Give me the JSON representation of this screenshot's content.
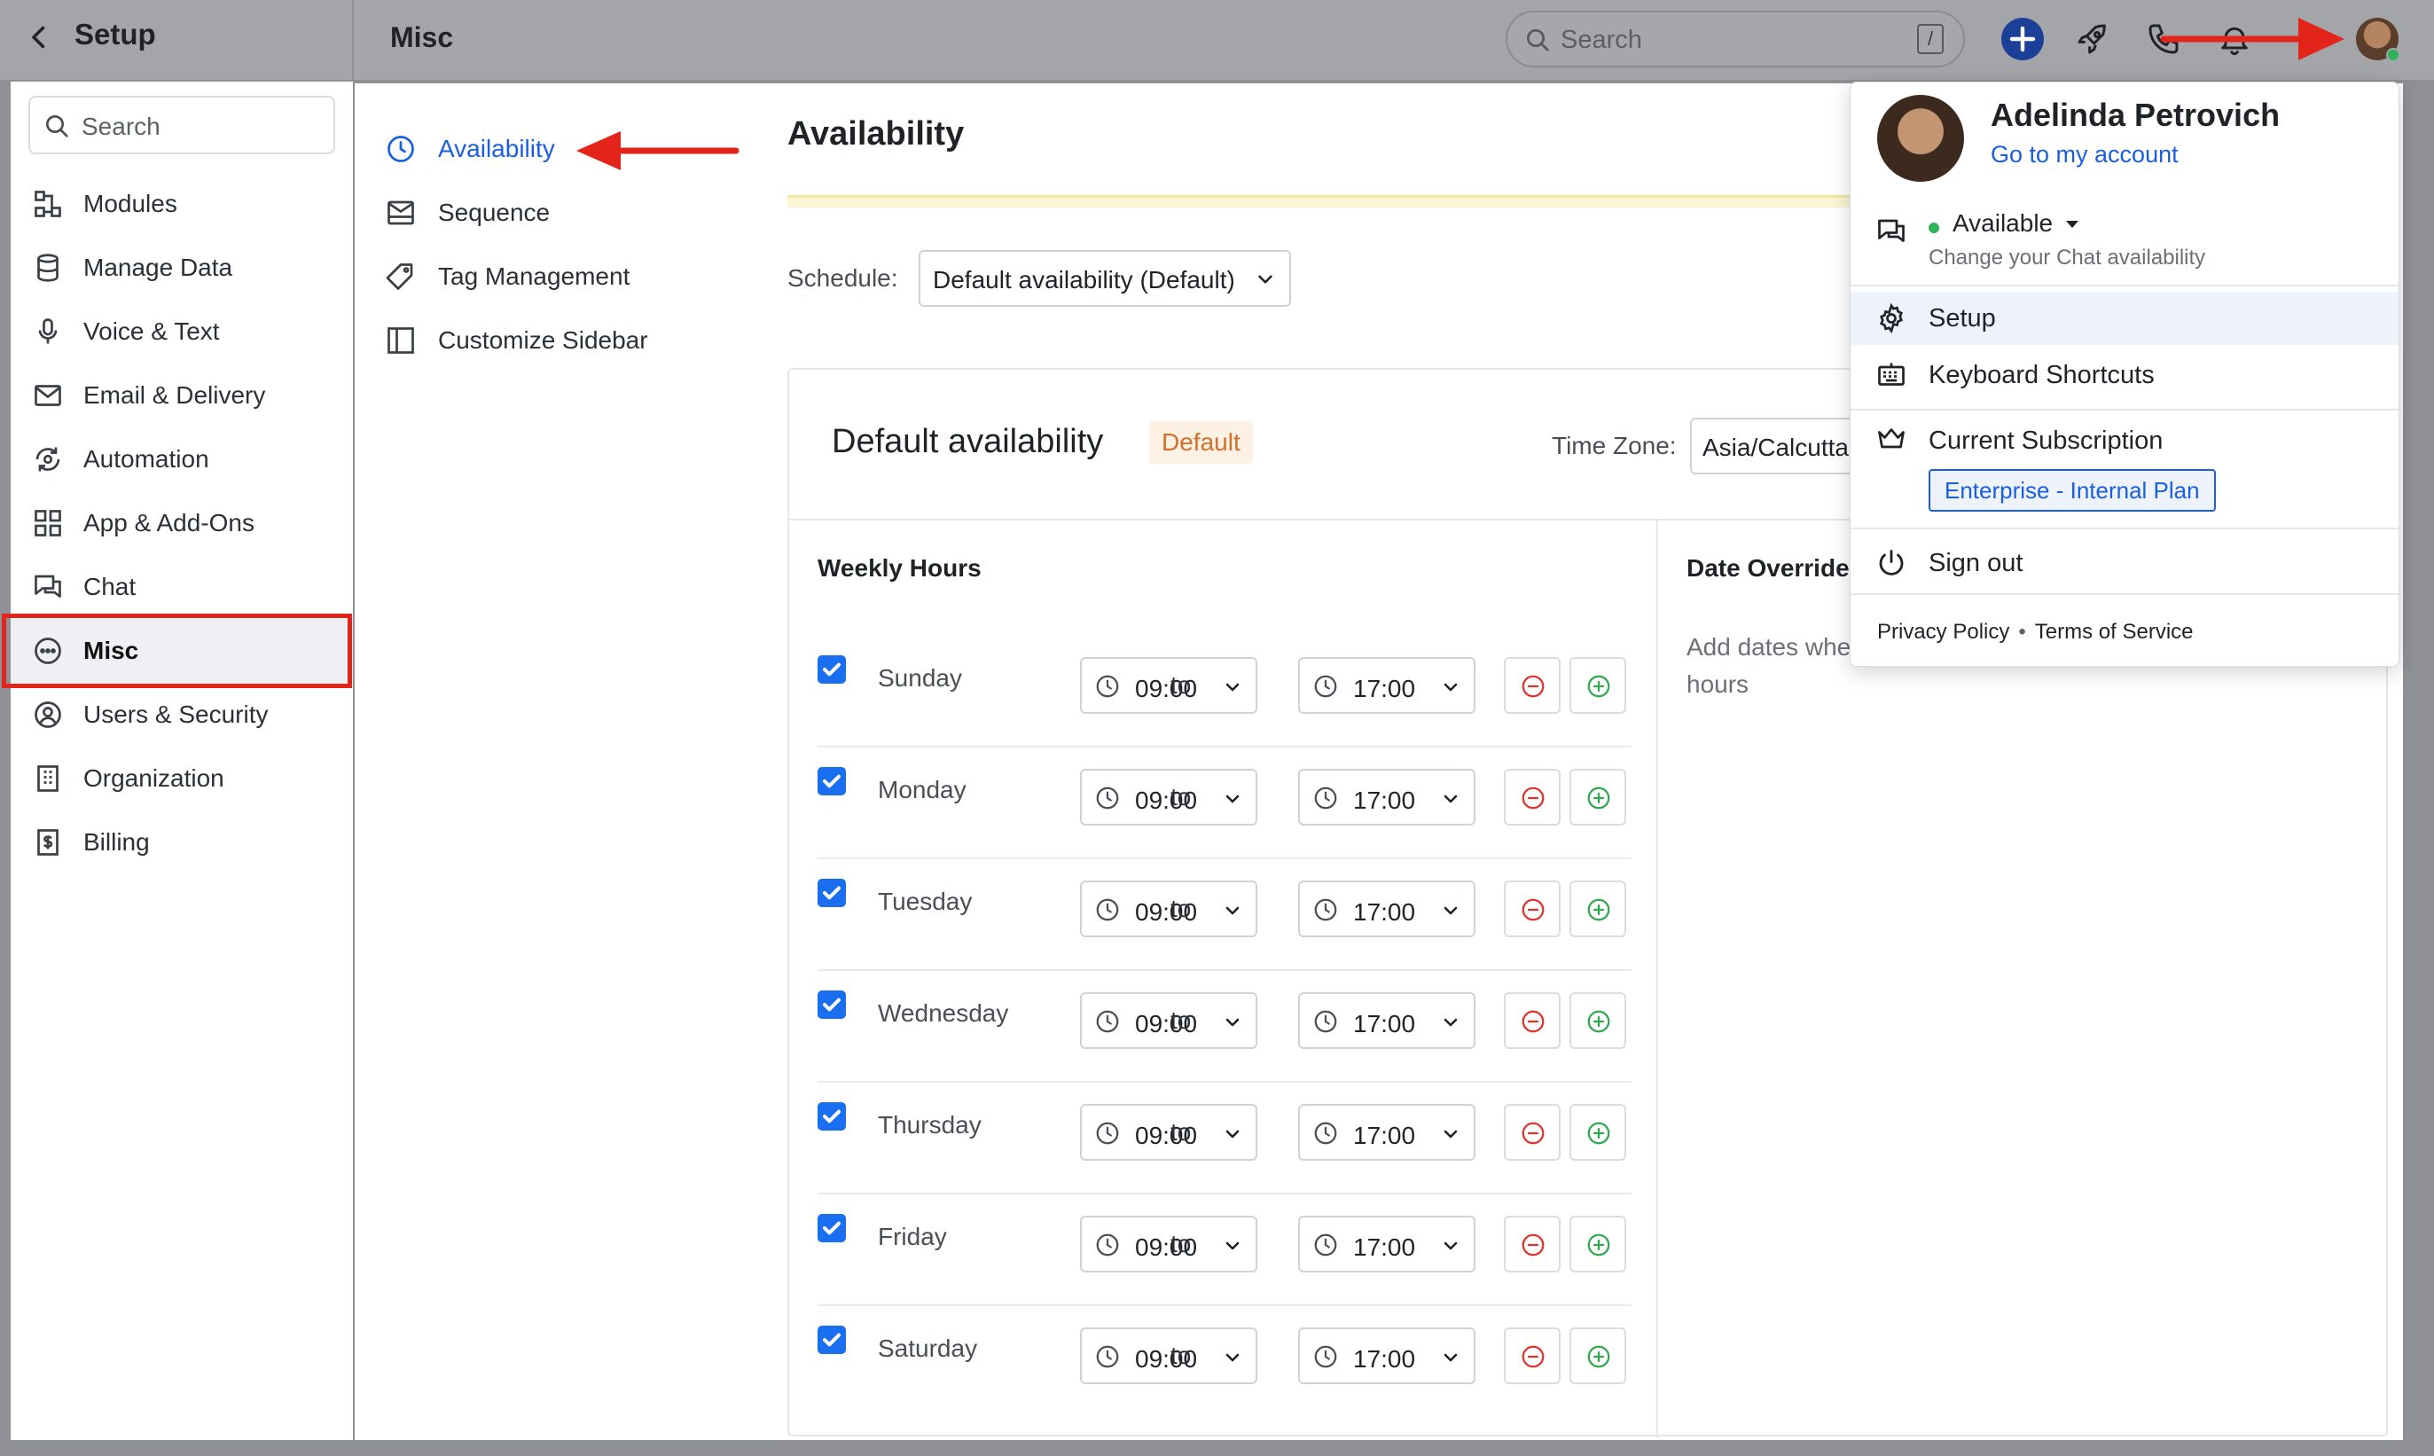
{
  "header": {
    "setup_title": "Setup",
    "misc_title": "Misc",
    "search_placeholder": "Search",
    "search_shortcut": "/"
  },
  "sidebar": {
    "search_placeholder": "Search",
    "items": [
      {
        "label": "Modules",
        "icon": "modules-icon"
      },
      {
        "label": "Manage Data",
        "icon": "database-icon"
      },
      {
        "label": "Voice & Text",
        "icon": "microphone-icon"
      },
      {
        "label": "Email & Delivery",
        "icon": "envelope-icon"
      },
      {
        "label": "Automation",
        "icon": "automation-icon"
      },
      {
        "label": "App & Add-Ons",
        "icon": "apps-grid-icon"
      },
      {
        "label": "Chat",
        "icon": "chat-icon"
      },
      {
        "label": "Misc",
        "icon": "more-circle-icon",
        "active": true
      },
      {
        "label": "Users & Security",
        "icon": "user-circle-icon"
      },
      {
        "label": "Organization",
        "icon": "building-icon"
      },
      {
        "label": "Billing",
        "icon": "billing-icon"
      }
    ]
  },
  "subnav": {
    "items": [
      {
        "label": "Availability",
        "icon": "clock-icon",
        "active": true
      },
      {
        "label": "Sequence",
        "icon": "sequence-mail-icon"
      },
      {
        "label": "Tag Management",
        "icon": "tag-icon"
      },
      {
        "label": "Customize Sidebar",
        "icon": "sidebar-layout-icon"
      }
    ]
  },
  "main": {
    "title": "Availability",
    "schedule_label": "Schedule:",
    "schedule_value": "Default availability (Default)",
    "card_title": "Default availability",
    "default_badge": "Default",
    "timezone_label": "Time Zone:",
    "timezone_value": "Asia/Calcutta",
    "weekly_title": "Weekly Hours",
    "override_title": "Date Override",
    "override_text": "Add dates whe weekly hours",
    "to_label": "to",
    "days": [
      {
        "name": "Sunday",
        "checked": true,
        "from": "09:00",
        "to": "17:00"
      },
      {
        "name": "Monday",
        "checked": true,
        "from": "09:00",
        "to": "17:00"
      },
      {
        "name": "Tuesday",
        "checked": true,
        "from": "09:00",
        "to": "17:00"
      },
      {
        "name": "Wednesday",
        "checked": true,
        "from": "09:00",
        "to": "17:00"
      },
      {
        "name": "Thursday",
        "checked": true,
        "from": "09:00",
        "to": "17:00"
      },
      {
        "name": "Friday",
        "checked": true,
        "from": "09:00",
        "to": "17:00"
      },
      {
        "name": "Saturday",
        "checked": true,
        "from": "09:00",
        "to": "17:00"
      }
    ]
  },
  "menu": {
    "user_name": "Adelinda Petrovich",
    "account_link": "Go to my account",
    "status": "Available",
    "status_sub": "Change your Chat availability",
    "setup": "Setup",
    "shortcuts": "Keyboard Shortcuts",
    "subscription": "Current Subscription",
    "plan": "Enterprise - Internal Plan",
    "sign_out": "Sign out",
    "privacy": "Privacy Policy",
    "terms": "Terms of Service"
  },
  "colors": {
    "accent": "#1a5fe0",
    "highlight": "#e3241b",
    "status_green": "#2fb35a",
    "checkbox": "#1a6ff0",
    "remove": "#e0332b",
    "add": "#2fa84f"
  }
}
